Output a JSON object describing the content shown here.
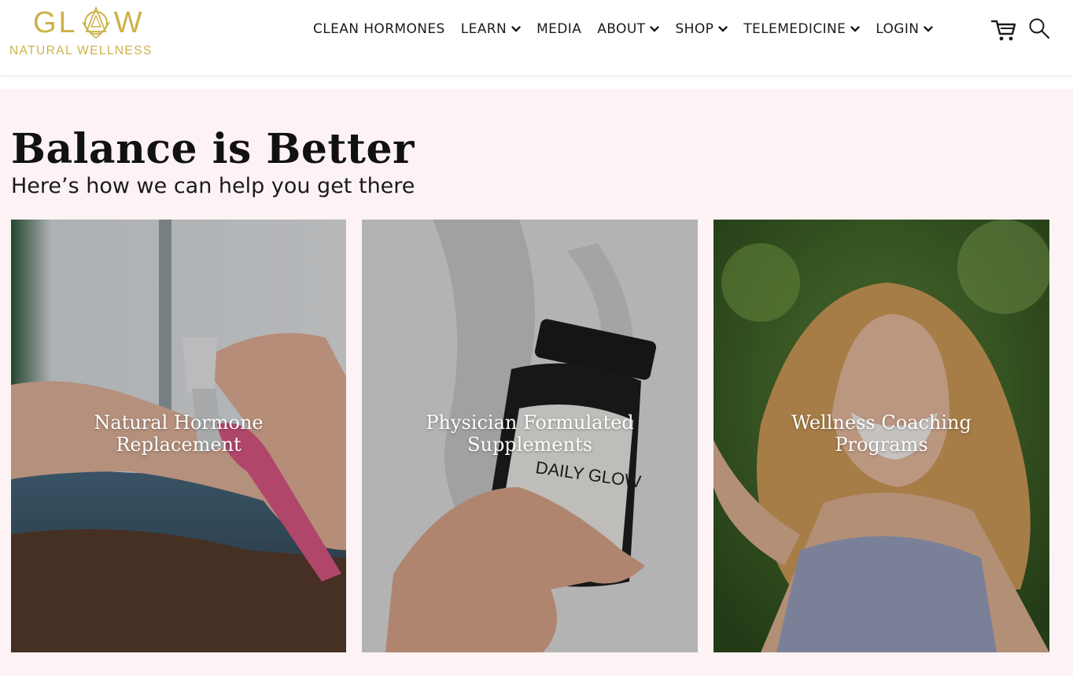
{
  "brand": {
    "logo_word_left": "GL",
    "logo_word_right": "W",
    "logo_subtitle": "NATURAL WELLNESS",
    "color": "#cdb249"
  },
  "nav": {
    "items": [
      {
        "label": "CLEAN HORMONES",
        "has_dropdown": false
      },
      {
        "label": "LEARN",
        "has_dropdown": true
      },
      {
        "label": "MEDIA",
        "has_dropdown": false
      },
      {
        "label": "ABOUT",
        "has_dropdown": true
      },
      {
        "label": "SHOP",
        "has_dropdown": true
      },
      {
        "label": "TELEMEDICINE",
        "has_dropdown": true
      },
      {
        "label": "LOGIN",
        "has_dropdown": true
      }
    ],
    "icons": [
      "cart-icon",
      "search-icon"
    ]
  },
  "hero": {
    "title": "Balance is Better",
    "subtitle": "Here’s how we can help you get there",
    "background": "#fdf3f4"
  },
  "cards": [
    {
      "label": "Natural Hormone Replacement",
      "image": "hand-spraying-bottle-photo"
    },
    {
      "label": "Physician Formulated Supplements",
      "image": "supplement-bottle-photo",
      "product_text": "DAILY GLOW"
    },
    {
      "label": "Wellness Coaching Programs",
      "image": "smiling-woman-photo"
    }
  ]
}
